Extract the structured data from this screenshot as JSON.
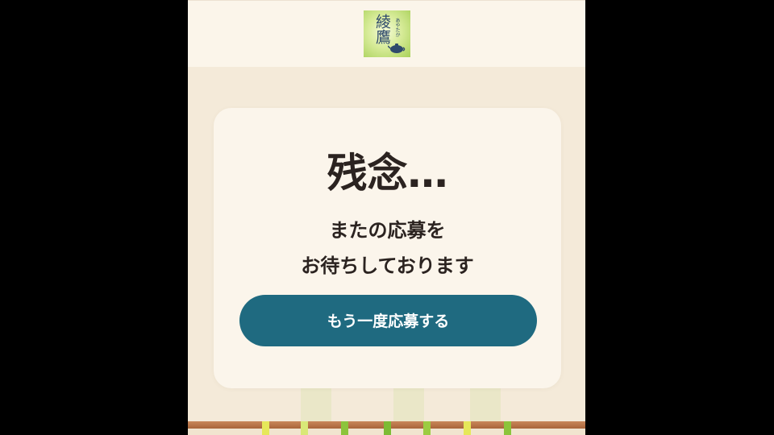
{
  "header": {
    "logo": {
      "kanji": "綾鷹",
      "kana": "あやたか",
      "icon": "teapot-icon"
    }
  },
  "result": {
    "title": "残念…",
    "message_line1": "またの応募を",
    "message_line2": "お待ちしております",
    "retry_label": "もう一度応募する"
  },
  "colors": {
    "background": "#f4ead9",
    "card": "#fbf5eb",
    "button": "#1f6a80",
    "text": "#2b2320",
    "logo_green": "#a9d15a"
  }
}
